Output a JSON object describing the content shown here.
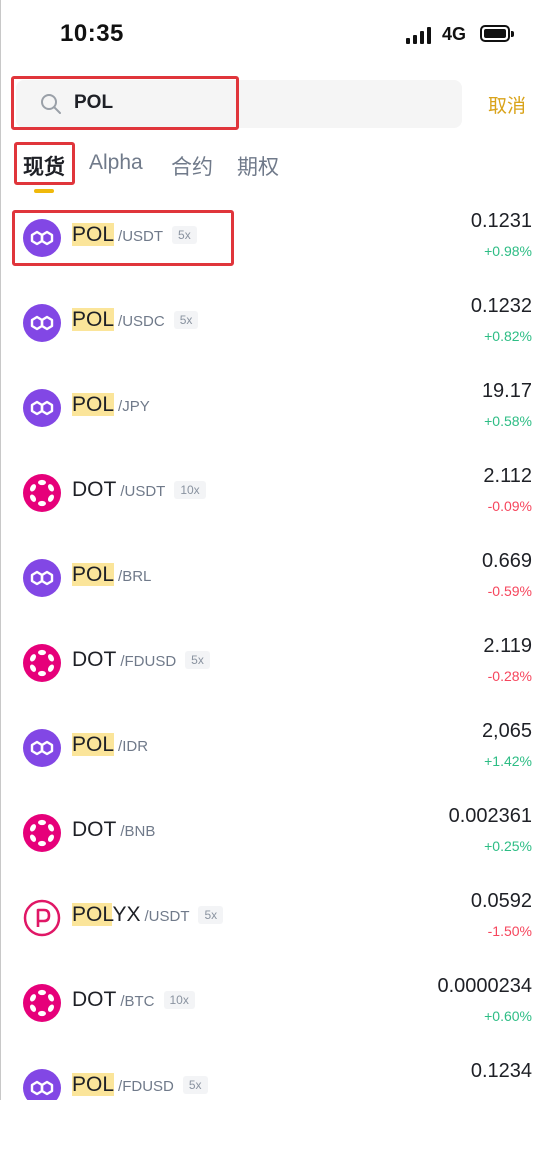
{
  "status_bar": {
    "time": "10:35",
    "network": "4G"
  },
  "search": {
    "value": "POL",
    "cancel_label": "取消"
  },
  "tabs": [
    {
      "label": "现货",
      "active": true
    },
    {
      "label": "Alpha",
      "active": false
    },
    {
      "label": "合约",
      "active": false
    },
    {
      "label": "期权",
      "active": false
    }
  ],
  "colors": {
    "accent": "#f0b90b",
    "positive": "#2ebd85",
    "negative": "#f6465d",
    "highlight": "#fbe59a",
    "annotation": "#e0353b"
  },
  "list": [
    {
      "icon": "polygon-coin-icon",
      "base_match": "POL",
      "base_rest": "",
      "quote": "/USDT",
      "leverage": "5x",
      "price": "0.1231",
      "change": "+0.98%",
      "direction": "up"
    },
    {
      "icon": "polygon-coin-icon",
      "base_match": "POL",
      "base_rest": "",
      "quote": "/USDC",
      "leverage": "5x",
      "price": "0.1232",
      "change": "+0.82%",
      "direction": "up"
    },
    {
      "icon": "polygon-coin-icon",
      "base_match": "POL",
      "base_rest": "",
      "quote": "/JPY",
      "leverage": "",
      "price": "19.17",
      "change": "+0.58%",
      "direction": "up"
    },
    {
      "icon": "polkadot-coin-icon",
      "base_match": "",
      "base_rest": "DOT",
      "quote": "/USDT",
      "leverage": "10x",
      "price": "2.112",
      "change": "-0.09%",
      "direction": "down"
    },
    {
      "icon": "polygon-coin-icon",
      "base_match": "POL",
      "base_rest": "",
      "quote": "/BRL",
      "leverage": "",
      "price": "0.669",
      "change": "-0.59%",
      "direction": "down"
    },
    {
      "icon": "polkadot-coin-icon",
      "base_match": "",
      "base_rest": "DOT",
      "quote": "/FDUSD",
      "leverage": "5x",
      "price": "2.119",
      "change": "-0.28%",
      "direction": "down"
    },
    {
      "icon": "polygon-coin-icon",
      "base_match": "POL",
      "base_rest": "",
      "quote": "/IDR",
      "leverage": "",
      "price": "2,065",
      "change": "+1.42%",
      "direction": "up"
    },
    {
      "icon": "polkadot-coin-icon",
      "base_match": "",
      "base_rest": "DOT",
      "quote": "/BNB",
      "leverage": "",
      "price": "0.002361",
      "change": "+0.25%",
      "direction": "up"
    },
    {
      "icon": "polymesh-coin-icon",
      "base_match": "POL",
      "base_rest": "YX",
      "quote": "/USDT",
      "leverage": "5x",
      "price": "0.0592",
      "change": "-1.50%",
      "direction": "down"
    },
    {
      "icon": "polkadot-coin-icon",
      "base_match": "",
      "base_rest": "DOT",
      "quote": "/BTC",
      "leverage": "10x",
      "price": "0.0000234",
      "change": "+0.60%",
      "direction": "up"
    },
    {
      "icon": "polygon-coin-icon",
      "base_match": "POL",
      "base_rest": "",
      "quote": "/FDUSD",
      "leverage": "5x",
      "price": "0.1234",
      "change": "",
      "direction": "up"
    }
  ]
}
